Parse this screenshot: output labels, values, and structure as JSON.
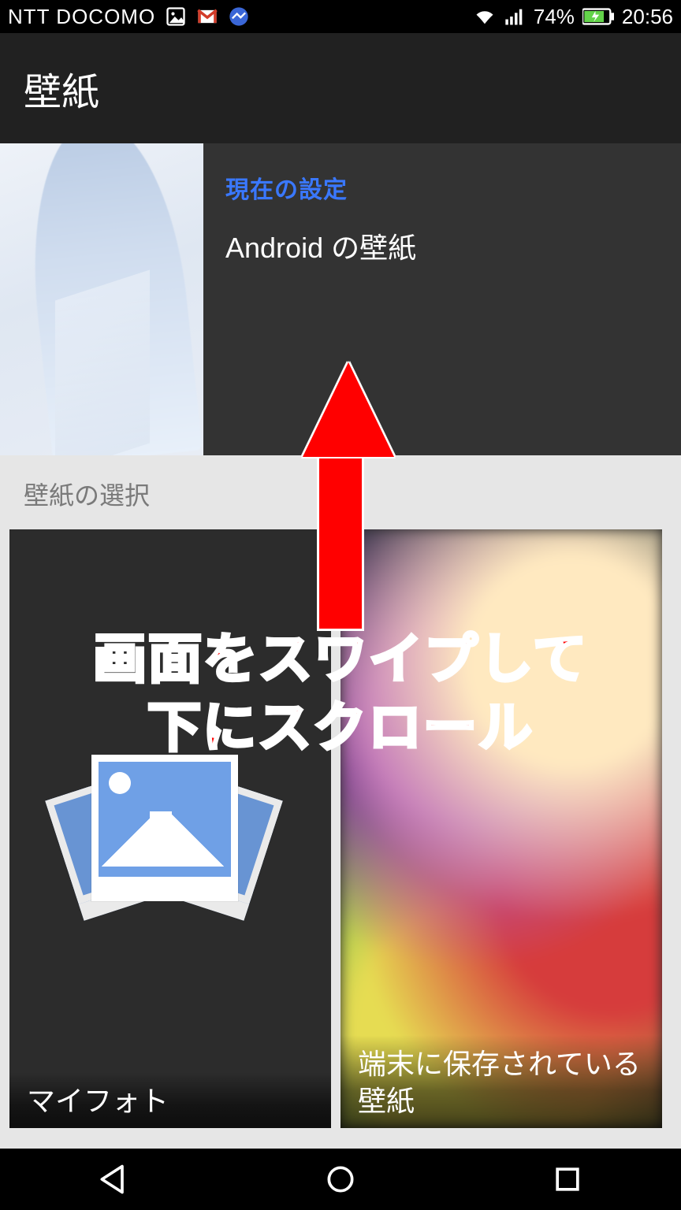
{
  "status": {
    "carrier": "NTT DOCOMO",
    "battery_pct": "74%",
    "time": "20:56",
    "icons": {
      "image": "image-icon",
      "gmail": "gmail-icon",
      "app": "app-circle-icon",
      "wifi": "wifi-icon",
      "signal": "cellular-signal-icon",
      "battery": "battery-charging-icon"
    }
  },
  "appbar": {
    "title": "壁紙"
  },
  "current": {
    "label": "現在の設定",
    "title": "Android の壁紙"
  },
  "section": {
    "header": "壁紙の選択"
  },
  "tiles": {
    "my_photos": {
      "caption": "マイフォト"
    },
    "on_device": {
      "caption": "端末に保存されている壁紙"
    }
  },
  "nav": {
    "back": "back-icon",
    "home": "home-icon",
    "recent": "recent-icon"
  },
  "annotation": {
    "line1": "画面をスワイプして",
    "line2": "下にスクロール"
  }
}
